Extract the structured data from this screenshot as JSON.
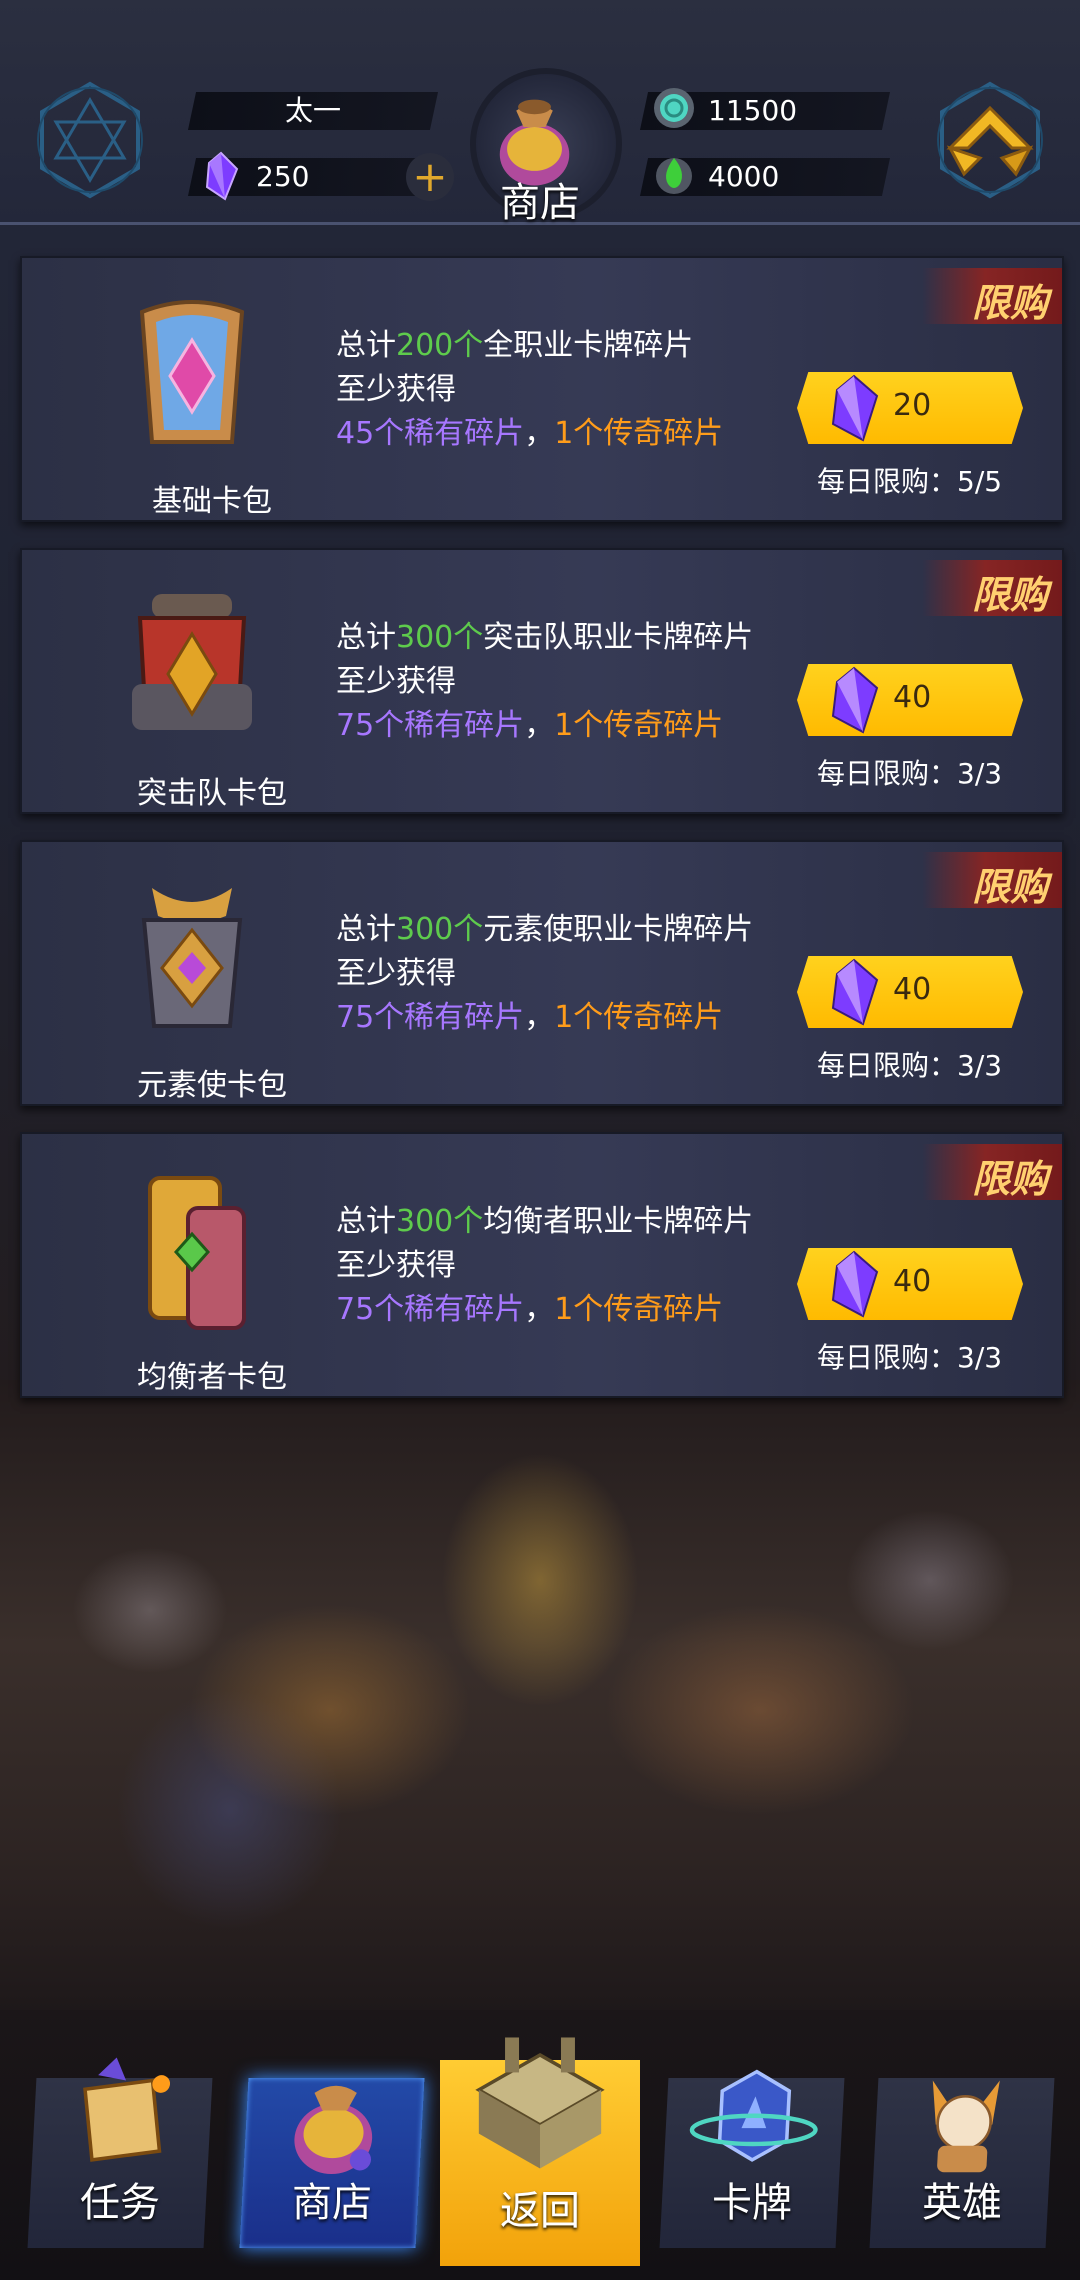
{
  "header": {
    "player_name": "太一",
    "gems": "250",
    "currency_a": "11500",
    "currency_b": "4000",
    "title": "商店",
    "icons": [
      "hexagram-emblem-icon",
      "purple-gem-icon",
      "plus-icon",
      "teal-coin-icon",
      "green-flame-icon",
      "shop-bag-icon",
      "back-arrow-icon"
    ]
  },
  "offers": [
    {
      "name": "基础卡包",
      "prefix": "总计",
      "count": "200个",
      "desc_rest": "全职业卡牌碎片",
      "line2": "至少获得",
      "rare": "45个稀有碎片",
      "sep": "，",
      "legend": "1个传奇碎片",
      "tag": "限购",
      "price": "20",
      "daily": "每日限购：5/5"
    },
    {
      "name": "突击队卡包",
      "prefix": "总计",
      "count": "300个",
      "desc_rest": "突击队职业卡牌碎片",
      "line2": "至少获得",
      "rare": "75个稀有碎片",
      "sep": "，",
      "legend": "1个传奇碎片",
      "tag": "限购",
      "price": "40",
      "daily": "每日限购：3/3"
    },
    {
      "name": "元素使卡包",
      "prefix": "总计",
      "count": "300个",
      "desc_rest": "元素使职业卡牌碎片",
      "line2": "至少获得",
      "rare": "75个稀有碎片",
      "sep": "，",
      "legend": "1个传奇碎片",
      "tag": "限购",
      "price": "40",
      "daily": "每日限购：3/3"
    },
    {
      "name": "均衡者卡包",
      "prefix": "总计",
      "count": "300个",
      "desc_rest": "均衡者职业卡牌碎片",
      "line2": "至少获得",
      "rare": "75个稀有碎片",
      "sep": "，",
      "legend": "1个传奇碎片",
      "tag": "限购",
      "price": "40",
      "daily": "每日限购：3/3"
    }
  ],
  "nav": {
    "tasks": "任务",
    "shop": "商店",
    "back": "返回",
    "cards": "卡牌",
    "heroes": "英雄"
  },
  "colors": {
    "highlight_green": "#5ecb4c",
    "rare_purple": "#a777ff",
    "legend_orange": "#ff9c1a",
    "buy_yellow": "#ffc20e",
    "nav_active_blue": "#234aa8"
  }
}
